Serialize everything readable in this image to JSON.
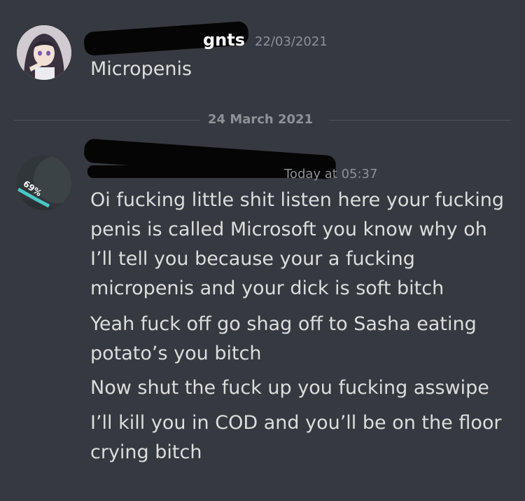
{
  "colors": {
    "background": "#36393f",
    "username": "#ffffff",
    "message_text": "#dcddde",
    "muted": "#8e9297",
    "divider": "#4f545c"
  },
  "messages": [
    {
      "author": "gnts",
      "timestamp": "22/03/2021",
      "avatar": "anime-girl-avatar",
      "lines": [
        "Micropenis"
      ]
    },
    {
      "author": "",
      "timestamp": "Today at 05:37",
      "avatar": "battery-widget-avatar",
      "avatar_badge": "69%",
      "lines": [
        "Oi fucking little shit listen here your fucking",
        "penis is called Microsoft you know why oh",
        "I’ll tell you because your a fucking",
        "micropenis  and your dick is soft bitch",
        "Yeah fuck off go shag off to Sasha eating",
        "potato’s you bitch",
        "Now shut the fuck up you fucking asswipe",
        "I’ll kill you in COD and you’ll be on the floor",
        "crying bitch"
      ]
    }
  ],
  "date_divider": "24 March 2021"
}
